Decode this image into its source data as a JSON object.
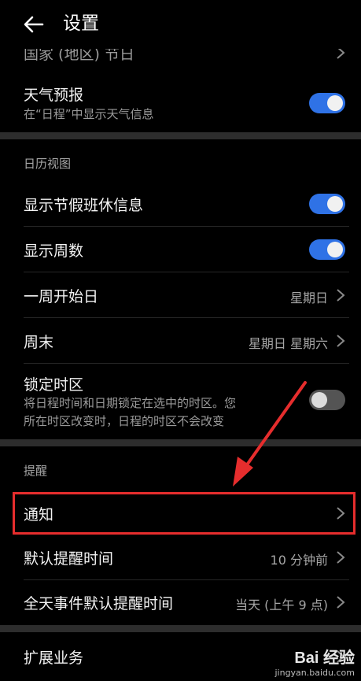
{
  "header": {
    "title": "设置"
  },
  "rows": {
    "holidays_partial": "国家 (地区) 节日",
    "weather": {
      "label": "天气预报",
      "sub": "在“日程”中显示天气信息"
    },
    "calendar_section": "日历视图",
    "show_holiday": {
      "label": "显示节假班休信息"
    },
    "show_week_number": {
      "label": "显示周数"
    },
    "week_start": {
      "label": "一周开始日",
      "value": "星期日"
    },
    "weekend": {
      "label": "周末",
      "value": "星期日 星期六"
    },
    "lock_timezone": {
      "label": "锁定时区",
      "sub1": "将日程时间和日期锁定在选中的时区。您",
      "sub2": "所在时区改变时，日程的时区不会改变"
    },
    "reminder_section": "提醒",
    "notification": {
      "label": "通知"
    },
    "default_reminder": {
      "label": "默认提醒时间",
      "value": "10 分钟前"
    },
    "allday_reminder": {
      "label": "全天事件默认提醒时间",
      "value": "当天 (上午 9 点)"
    },
    "extension": {
      "label": "扩展业务"
    }
  },
  "toggles": {
    "weather": true,
    "show_holiday": true,
    "show_week_number": true,
    "lock_timezone": false
  },
  "colors": {
    "accent": "#2f72e6",
    "annotation": "#e62d2d"
  },
  "watermark": {
    "logo": "Bai 经验",
    "url": "jingyan.baidu.com"
  }
}
